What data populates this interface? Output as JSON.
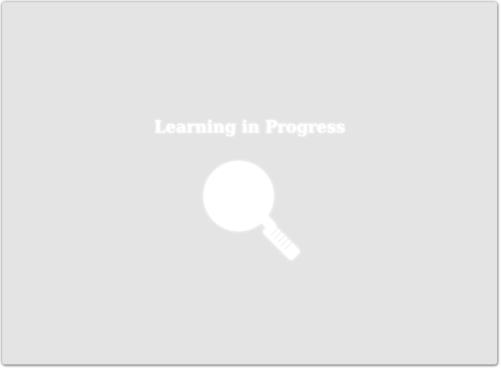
{
  "loading_panel": {
    "title": "Learning in Progress",
    "icon": "magnifying-glass-icon",
    "colors": {
      "background": "#e4e4e4",
      "foreground": "#ffffff"
    }
  }
}
